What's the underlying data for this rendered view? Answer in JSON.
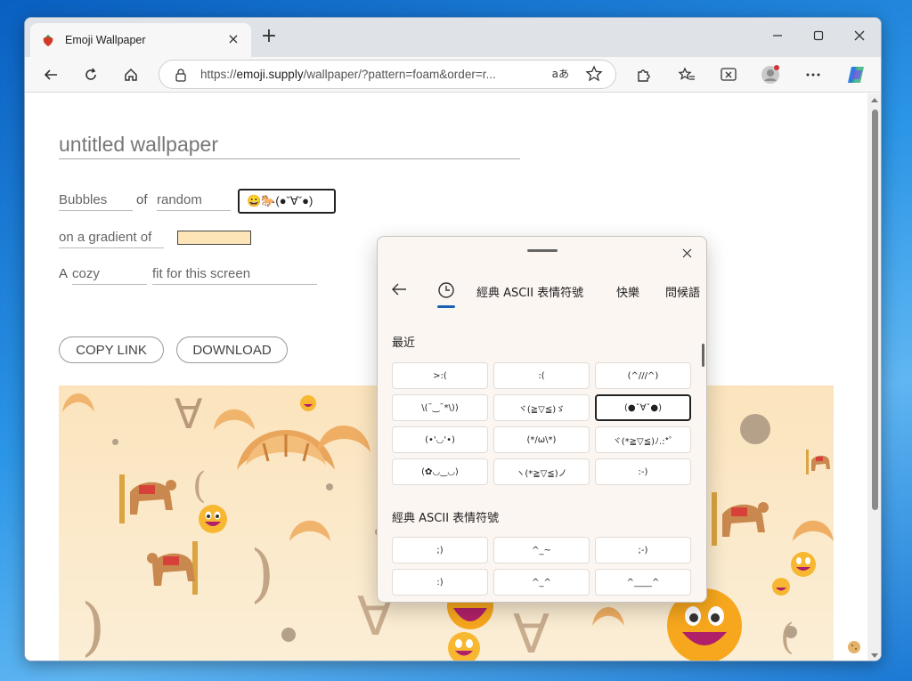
{
  "browser": {
    "tab_title": "Emoji Wallpaper",
    "tab_close": "×",
    "new_tab": "+",
    "url_prefix": "https://",
    "url_domain": "emoji.supply",
    "url_rest": "/wallpaper/?pattern=foam&order=r...",
    "read_aloud": "aあ"
  },
  "page": {
    "title": "untitled wallpaper",
    "pattern": "Bubbles",
    "of": "of",
    "order": "random",
    "emoji_selection": "😀🐎(●ˇ∀ˇ●)",
    "gradient_label": "on a gradient of",
    "gradient_color": "#fde5b8",
    "a": "A",
    "mood": "cozy",
    "fit_label": "fit for this screen",
    "copy_link": "COPY LINK",
    "download": "DOWNLOAD"
  },
  "emoji_panel": {
    "tabs": [
      "經典 ASCII 表情符號",
      "快樂",
      "問候語"
    ],
    "recent_heading": "最近",
    "recent": [
      ">:(",
      ":(",
      "(^///^)",
      "\\(¯‿¯*\\))",
      "ヾ(≧▽≦)ゞ",
      "(●ˇ∀ˇ●)",
      "(•'◡'•)",
      "(*/ω\\*)",
      "ヾ(*≧▽≦)ﾉ.:*ﾟ",
      "(✿◡‿◡)",
      "ヽ(*≧▽≦)ノ",
      ":-)"
    ],
    "selected_index": 5,
    "ascii_heading": "經典 ASCII 表情符號",
    "ascii": [
      ";)",
      "^_~",
      ";-)",
      ":)",
      "^_^",
      "^____^"
    ]
  },
  "colors": {
    "accent": "#1a5fb4",
    "gradient": "#fde5b8"
  }
}
